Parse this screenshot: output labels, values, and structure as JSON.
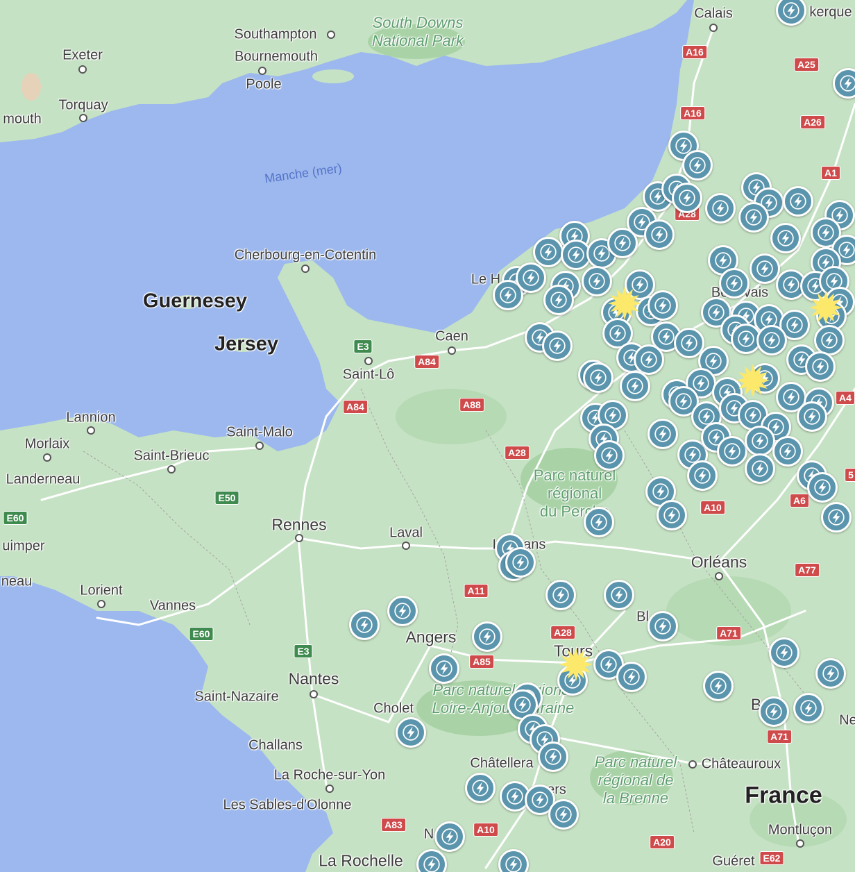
{
  "map": {
    "colors": {
      "water": "#9cb8ee",
      "land": "#c6e2c4",
      "forest": "#a9d3a6",
      "road": "#ffffff",
      "charger": "#5a95ad",
      "highlight": "#fce86a",
      "label": "#3c3c3c",
      "park_label": "#5e9e6e"
    },
    "icons": {
      "charger": "lightning-bolt-icon",
      "highlight": "starburst-icon"
    },
    "labels": {
      "calais": "Calais",
      "dunkerque": "kerque",
      "southampton": "Southampton",
      "bournemouth": "Bournemouth",
      "poole": "Poole",
      "exeter": "Exeter",
      "torquay": "Torquay",
      "plymouth": "mouth",
      "south_downs": "South Downs\nNational Park",
      "manche": "Manche (mer)",
      "cherbourg": "Cherbourg-en-Cotentin",
      "guernesey": "Guernesey",
      "jersey": "Jersey",
      "le_havre": "Le H",
      "caen": "Caen",
      "saint_lo": "Saint-Lô",
      "beauvais": "Beauvais",
      "lannion": "Lannion",
      "morlaix": "Morlaix",
      "saint_brieuc": "Saint-Brieuc",
      "saint_malo": "Saint-Malo",
      "landerneau": "Landerneau",
      "quimper": "uimper",
      "quimperle": "neau",
      "lorient": "Lorient",
      "vannes": "Vannes",
      "rennes": "Rennes",
      "laval": "Laval",
      "le_mans": "Le Mans",
      "perche": "Parc naturel\nrégional\ndu Perche",
      "orleans": "Orléans",
      "angers": "Angers",
      "nantes": "Nantes",
      "saint_nazaire": "Saint-Nazaire",
      "cholet": "Cholet",
      "loire_anjou": "Parc naturel régional\nLoire-Anjou-Touraine",
      "tours": "Tours",
      "blois": "Bl",
      "bourges": "Bo",
      "nevers": "Ne",
      "challans": "Challans",
      "la_roche": "La Roche-sur-Yon",
      "sables": "Les Sables-d'Olonne",
      "chatellerault": "Châtellera",
      "poitiers": "ers",
      "niort": "N",
      "brenne": "Parc naturel\nrégional de\nla Brenne",
      "chateauroux": "Châteauroux",
      "france": "France",
      "montlucon": "Montluçon",
      "gueret": "Guéret",
      "la_rochelle": "La Rochelle"
    },
    "roads": {
      "a16a": "A16",
      "a25": "A25",
      "a16b": "A16",
      "a26": "A26",
      "a1": "A1",
      "a28a": "A28",
      "e3a": "E3",
      "a84a": "A84",
      "a84b": "A84",
      "a88": "A88",
      "a28b": "A28",
      "e50": "E50",
      "e60a": "E60",
      "a10a": "A10",
      "a6": "A6",
      "a5": "5",
      "a4": "A4",
      "a77": "A77",
      "a11": "A11",
      "a28c": "A28",
      "e60b": "E60",
      "e3b": "E3",
      "a85": "A85",
      "a71a": "A71",
      "a71b": "A71",
      "a83": "A83",
      "a10b": "A10",
      "a20": "A20",
      "e62": "E62"
    }
  }
}
